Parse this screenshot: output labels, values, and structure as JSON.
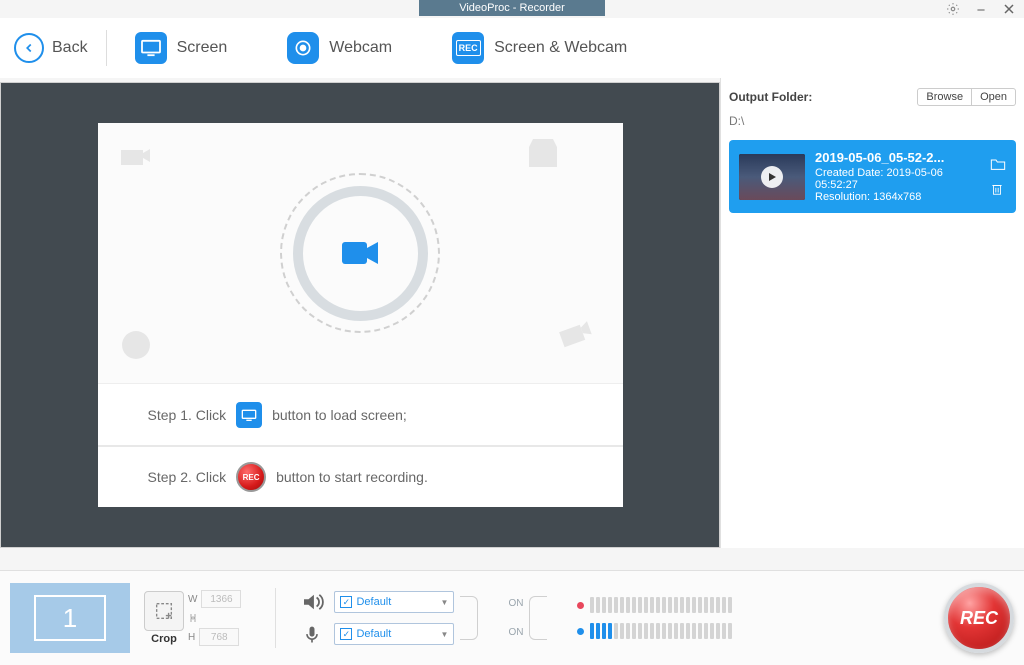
{
  "title": "VideoProc - Recorder",
  "toolbar": {
    "back": "Back",
    "screen": "Screen",
    "webcam": "Webcam",
    "screen_webcam": "Screen & Webcam"
  },
  "steps": {
    "s1a": "Step 1. Click",
    "s1b": "button to load screen;",
    "s2a": "Step 2. Click",
    "s2b": "button to start recording."
  },
  "sidebar": {
    "folder_label": "Output Folder:",
    "browse": "Browse",
    "open": "Open",
    "path": "D:\\",
    "record": {
      "title": "2019-05-06_05-52-2...",
      "created": "Created Date: 2019-05-06 05:52:27",
      "resolution": "Resolution: 1364x768"
    }
  },
  "bottom": {
    "monitor_count": "1",
    "crop": "Crop",
    "w_label": "W",
    "h_label": "H",
    "width": "1366",
    "height": "768",
    "speaker_sel": "Default",
    "mic_sel": "Default",
    "speaker_state": "ON",
    "mic_state": "ON",
    "rec": "REC",
    "rec_small": "REC"
  }
}
